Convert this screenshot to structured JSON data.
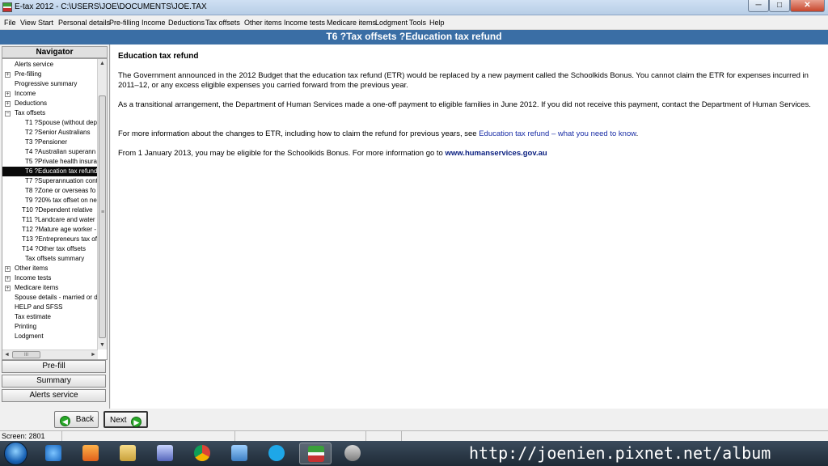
{
  "window": {
    "title": "E-tax 2012 - C:\\USERS\\JOE\\DOCUMENTS\\JOE.TAX",
    "minimize_label": "─",
    "maximize_label": "□",
    "close_label": "✕"
  },
  "menu": [
    "File",
    "View",
    "Start",
    "Personal details",
    "Pre-filling",
    "Income",
    "Deductions",
    "Tax offsets",
    "Other items",
    "Income tests",
    "Medicare items",
    "Lodgment",
    "Tools",
    "Help"
  ],
  "header": {
    "title": "T6 ?Tax offsets ?Education tax refund"
  },
  "navigator": {
    "title": "Navigator",
    "items": [
      {
        "label": "Alerts service",
        "expander": ""
      },
      {
        "label": "Pre-filling",
        "expander": "+"
      },
      {
        "label": "Progressive summary",
        "expander": ""
      },
      {
        "label": "Income",
        "expander": "+"
      },
      {
        "label": "Deductions",
        "expander": "+"
      },
      {
        "label": "Tax offsets",
        "expander": "−"
      },
      {
        "label": "T1 ?Spouse (without dep",
        "expander": ""
      },
      {
        "label": "T2 ?Senior Australians",
        "expander": ""
      },
      {
        "label": "T3 ?Pensioner",
        "expander": ""
      },
      {
        "label": "T4 ?Australian superann",
        "expander": ""
      },
      {
        "label": "T5 ?Private health insura",
        "expander": ""
      },
      {
        "label": "T6 ?Education tax refund",
        "expander": ""
      },
      {
        "label": "T7 ?Superannuation cont",
        "expander": ""
      },
      {
        "label": "T8 ?Zone or overseas fo",
        "expander": ""
      },
      {
        "label": "T9 ?20% tax offset on ne",
        "expander": ""
      },
      {
        "label": "T10 ?Dependent relative",
        "expander": ""
      },
      {
        "label": "T11 ?Landcare and water",
        "expander": ""
      },
      {
        "label": "T12 ?Mature age worker -",
        "expander": ""
      },
      {
        "label": "T13 ?Entrepreneurs tax of",
        "expander": ""
      },
      {
        "label": "T14 ?Other tax offsets",
        "expander": ""
      },
      {
        "label": "Tax offsets summary",
        "expander": ""
      },
      {
        "label": "Other items",
        "expander": "+"
      },
      {
        "label": "Income tests",
        "expander": "+"
      },
      {
        "label": "Medicare items",
        "expander": "+"
      },
      {
        "label": "Spouse details - married or d",
        "expander": ""
      },
      {
        "label": "HELP and SFSS",
        "expander": ""
      },
      {
        "label": "Tax estimate",
        "expander": ""
      },
      {
        "label": "Printing",
        "expander": ""
      },
      {
        "label": "Lodgment",
        "expander": ""
      }
    ],
    "selected_index": 11,
    "scroll_up": "▲",
    "scroll_down": "▼",
    "scroll_left": "◄",
    "scroll_right": "►",
    "hscroll_grip": "III",
    "vscroll_grip": "≡",
    "buttons": [
      "Pre-fill",
      "Summary",
      "Alerts service"
    ]
  },
  "content": {
    "title": "Education tax refund",
    "p1": "The Government announced in the 2012 Budget that the education tax refund (ETR) would be replaced by a new payment called the Schoolkids Bonus. You cannot claim the ETR for expenses incurred in 2011–12, or any excess eligible expenses you carried forward from the previous year.",
    "p2": "As a transitional arrangement, the Department of Human Services made a one-off payment to eligible families in June 2012. If you did not receive this payment, contact the Department of Human Services.",
    "p3_text": "For more information about the changes to ETR, including how to claim the refund for previous years, see ",
    "p3_link": "Education tax refund – what you need to know",
    "p3_end": ".",
    "p4_text": "From 1 January 2013, you may be eligible for the Schoolkids Bonus. For more information go to ",
    "p4_link": "www.humanservices.gov.au"
  },
  "actions": {
    "back_label": "Back",
    "back_icon": "◀",
    "next_label": "Next",
    "next_icon": "▶"
  },
  "status": {
    "text": "Screen: 2801"
  },
  "watermark": "http://joenien.pixnet.net/album"
}
